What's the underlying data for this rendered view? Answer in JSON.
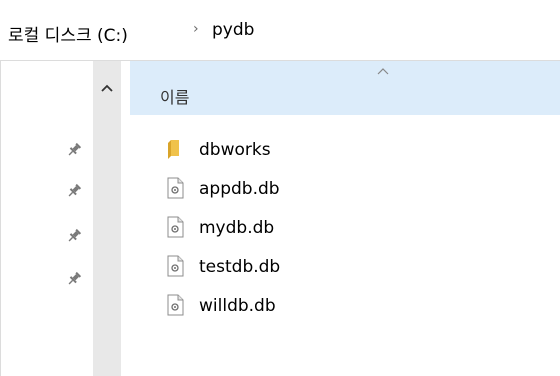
{
  "breadcrumb": {
    "root_label": "로컬 디스크 (C:)",
    "separator": "›",
    "folder_label": "pydb"
  },
  "file_list": {
    "header_name": "이름",
    "items": [
      {
        "name": "dbworks",
        "type": "folder",
        "icon": "folder-icon"
      },
      {
        "name": "appdb.db",
        "type": "file",
        "icon": "db-file-icon"
      },
      {
        "name": "mydb.db",
        "type": "file",
        "icon": "db-file-icon"
      },
      {
        "name": "testdb.db",
        "type": "file",
        "icon": "db-file-icon"
      },
      {
        "name": "willdb.db",
        "type": "file",
        "icon": "db-file-icon"
      }
    ]
  },
  "nav_pane": {
    "pins": [
      "pin-icon",
      "pin-icon",
      "pin-icon",
      "pin-icon"
    ]
  },
  "colors": {
    "header_bg": "#dcecfa",
    "scrollbar_bg": "#e8e8e8",
    "folder": "#f0c24b"
  }
}
